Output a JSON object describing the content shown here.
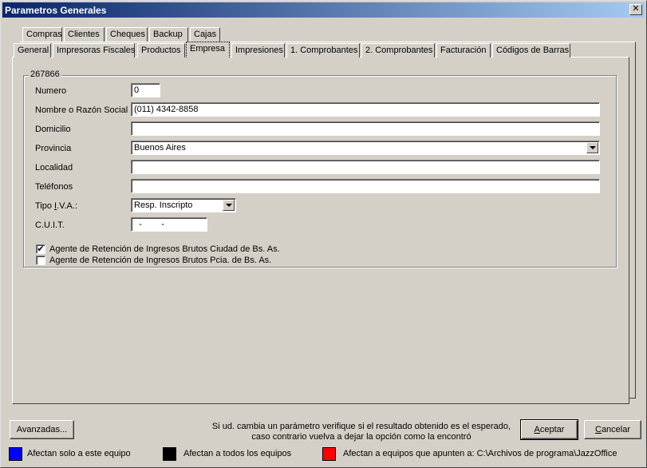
{
  "window": {
    "title": "Parametros Generales",
    "close_glyph": "✕"
  },
  "tabs_row1": [
    {
      "label": "Compras"
    },
    {
      "label": "Clientes"
    },
    {
      "label": "Cheques"
    },
    {
      "label": "Backup"
    },
    {
      "label": "Cajas"
    }
  ],
  "tabs_row2": [
    {
      "label": "General"
    },
    {
      "label": "Impresoras Fiscales"
    },
    {
      "label": "Productos"
    },
    {
      "label": "Empresa"
    },
    {
      "label": "Impresiones"
    },
    {
      "label": "1. Comprobantes"
    },
    {
      "label": "2. Comprobantes"
    },
    {
      "label": "Facturación"
    },
    {
      "label": "Códigos de Barras"
    }
  ],
  "active_tab": "Empresa",
  "group": {
    "title": "267866"
  },
  "form": {
    "numero": {
      "label": "Numero",
      "value": "0"
    },
    "nombre": {
      "label": "Nombre o Razón Social",
      "value": "(011) 4342-8858"
    },
    "domicilio": {
      "label": "Domicilio",
      "value": ""
    },
    "provincia": {
      "label": "Provincia",
      "value": "Buenos Aires"
    },
    "localidad": {
      "label": "Localidad",
      "value": ""
    },
    "telefonos": {
      "label": "Teléfonos",
      "value": ""
    },
    "tipo_iva": {
      "label_pre": "Tipo ",
      "label_ul": "I",
      "label_post": ".V.A.:",
      "value": "Resp. Inscripto"
    },
    "cuit": {
      "label": "C.U.I.T.",
      "value": "  -        -"
    }
  },
  "checkboxes": [
    {
      "label": "Agente de Retención de Ingresos Brutos Ciudad de Bs. As.",
      "checked": true,
      "mark": "✔"
    },
    {
      "label": "Agente de Retención de Ingresos Brutos Pcia. de Bs. As.",
      "checked": false,
      "mark": ""
    }
  ],
  "footer": {
    "avanzadas": "Avanzadas...",
    "message_line1": "Si ud. cambia un parámetro verifique si el resultado obtenido es el esperado,",
    "message_line2": "caso contrario vuelva a dejar la opción como la encontró",
    "aceptar_ul": "A",
    "aceptar_rest": "ceptar",
    "cancelar_ul": "C",
    "cancelar_rest": "ancelar"
  },
  "legend": [
    {
      "color": "#0000ff",
      "label": "Afectan solo a este equipo"
    },
    {
      "color": "#000000",
      "label": "Afectan a todos los equipos"
    },
    {
      "color": "#ff0000",
      "label": "Afectan a equipos que apunten a: C:\\Archivos de programa\\JazzOffice"
    }
  ]
}
